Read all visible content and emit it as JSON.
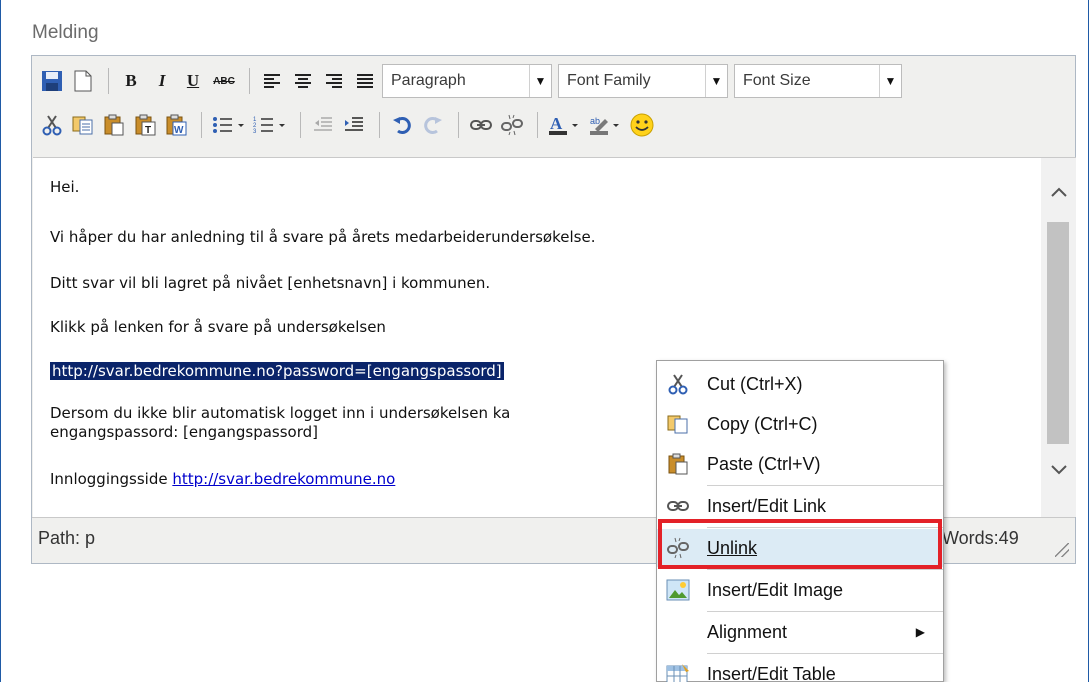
{
  "field_label": "Melding",
  "toolbar": {
    "format_select": "Paragraph",
    "font_family_select": "Font Family",
    "font_size_select": "Font Size"
  },
  "content": {
    "lines": [
      "Hei.",
      "Vi håper du har anledning til å svare på årets medarbeiderundersøkelse.",
      "Ditt svar vil bli lagret på nivået [enhetsnavn] i kommunen.",
      "Klikk på lenken for å svare på undersøkelsen"
    ],
    "selected_link": "http://svar.bedrekommune.no?password=[engangspassord]",
    "dersom_line1": "Dersom du ikke blir automatisk logget inn i undersøkelsen ka",
    "dersom_line2": "engangspassord: [engangspassord]",
    "login_prefix": "Innloggingsside ",
    "login_link": "http://svar.bedrekommune.no"
  },
  "status": {
    "path": "Path: p",
    "words": "Words:49"
  },
  "context_menu": {
    "cut": "Cut (Ctrl+X)",
    "copy": "Copy (Ctrl+C)",
    "paste": "Paste (Ctrl+V)",
    "insert_link": "Insert/Edit Link",
    "unlink": "Unlink",
    "insert_image": "Insert/Edit Image",
    "alignment": "Alignment",
    "insert_table": "Insert/Edit Table"
  },
  "colors": {
    "highlight_border": "#e32128",
    "selection_bg": "#0a246a",
    "menu_hover": "#dcebf5"
  }
}
